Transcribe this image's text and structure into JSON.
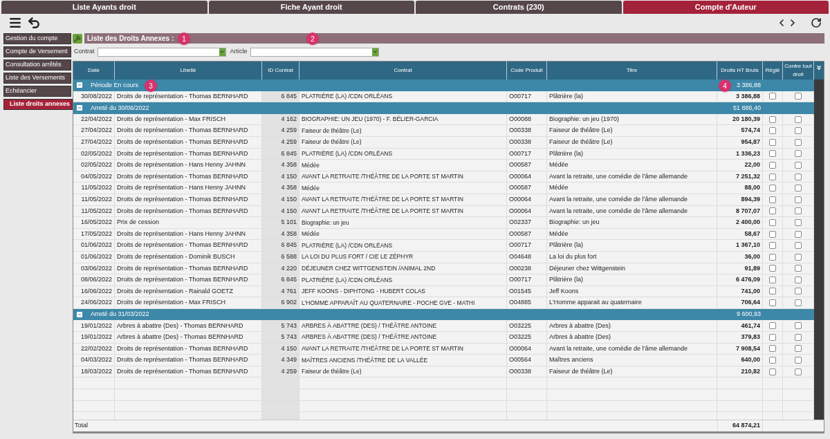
{
  "tabs": [
    {
      "label": "Liste Ayants droit",
      "selected": false
    },
    {
      "label": "Fiche Ayant droit",
      "selected": false
    },
    {
      "label": "Contrats (230)",
      "selected": false
    },
    {
      "label": "Compte d'Auteur",
      "selected": true
    }
  ],
  "sidebar": {
    "items": [
      {
        "label": "Gestion du compte",
        "selected": false
      },
      {
        "label": "Compte de Versement",
        "selected": false
      },
      {
        "label": "Consultation arrêtés",
        "selected": false
      },
      {
        "label": "Liste des Versements",
        "selected": false
      },
      {
        "label": "Echéancier",
        "selected": false
      },
      {
        "label": "Liste droits annexes",
        "selected": true
      }
    ]
  },
  "panel": {
    "title": "Liste des Droits Annexes :",
    "callouts": [
      "1",
      "2",
      "3",
      "4"
    ],
    "filters": [
      {
        "label": "Contrat"
      },
      {
        "label": "Article"
      }
    ]
  },
  "table": {
    "columns": [
      "Date",
      "Libellé",
      "ID Contrat",
      "Contrat",
      "Code Produit",
      "Titre",
      "Droits HT Bruts",
      "Réglé",
      "Contre tout droit"
    ],
    "groups": [
      {
        "label": "Période En cours",
        "total": "3 386,88",
        "expanded": true,
        "rows": [
          {
            "date": "30/08/2022",
            "libelle": "Droits de représentation - Thomas BERNHARD",
            "id_contrat": "6 845",
            "contrat": "PLATRIÈRE (LA) /CDN ORLÉANS",
            "code_produit": "O00717",
            "titre": "Plâtrière (la)",
            "droits": "3 386,88",
            "regle": false,
            "contre_tout_droit": false
          }
        ]
      },
      {
        "label": "Arreté du 30/06/2022",
        "total": "51 886,40",
        "expanded": true,
        "rows": [
          {
            "date": "22/04/2022",
            "libelle": "Droits de représentation - Max FRISCH",
            "id_contrat": "4 162",
            "contrat": "BIOGRAPHIE: UN JEU (1970) - F. BÉLIER-GARCIA",
            "code_produit": "O00088",
            "titre": "Biographie: un jeu (1970)",
            "droits": "20 180,39",
            "regle": false,
            "contre_tout_droit": false
          },
          {
            "date": "27/04/2022",
            "libelle": "Droits de représentation - Thomas BERNHARD",
            "id_contrat": "4 259",
            "contrat": "Faiseur de théâtre (Le)",
            "code_produit": "O00338",
            "titre": "Faiseur de théâtre (Le)",
            "droits": "574,74",
            "regle": false,
            "contre_tout_droit": false
          },
          {
            "date": "27/04/2022",
            "libelle": "Droits de représentation - Thomas BERNHARD",
            "id_contrat": "4 259",
            "contrat": "Faiseur de théâtre (Le)",
            "code_produit": "O00338",
            "titre": "Faiseur de théâtre (Le)",
            "droits": "954,87",
            "regle": false,
            "contre_tout_droit": false
          },
          {
            "date": "02/05/2022",
            "libelle": "Droits de représentation - Thomas BERNHARD",
            "id_contrat": "6 845",
            "contrat": "PLATRIÈRE (LA) /CDN ORLÉANS",
            "code_produit": "O00717",
            "titre": "Plâtrière (la)",
            "droits": "1 336,23",
            "regle": false,
            "contre_tout_droit": false
          },
          {
            "date": "02/05/2022",
            "libelle": "Droits de représentation - Hans Henny JAHNN",
            "id_contrat": "4 358",
            "contrat": "Médée",
            "code_produit": "O00587",
            "titre": "Médée",
            "droits": "22,00",
            "regle": false,
            "contre_tout_droit": false
          },
          {
            "date": "04/05/2022",
            "libelle": "Droits de représentation - Thomas BERNHARD",
            "id_contrat": "4 150",
            "contrat": "AVANT LA RETRAITE /THÉÂTRE DE LA PORTE ST MARTIN",
            "code_produit": "O00064",
            "titre": "Avant la retraite, une comédie de l’âme allemande",
            "droits": "7 251,32",
            "regle": false,
            "contre_tout_droit": false
          },
          {
            "date": "11/05/2022",
            "libelle": "Droits de représentation - Hans Henny JAHNN",
            "id_contrat": "4 358",
            "contrat": "Médée",
            "code_produit": "O00587",
            "titre": "Médée",
            "droits": "88,00",
            "regle": false,
            "contre_tout_droit": false
          },
          {
            "date": "11/05/2022",
            "libelle": "Droits de représentation - Thomas BERNHARD",
            "id_contrat": "4 150",
            "contrat": "AVANT LA RETRAITE /THÉÂTRE DE LA PORTE ST MARTIN",
            "code_produit": "O00064",
            "titre": "Avant la retraite, une comédie de l’âme allemande",
            "droits": "894,39",
            "regle": false,
            "contre_tout_droit": false
          },
          {
            "date": "11/05/2022",
            "libelle": "Droits de représentation - Thomas BERNHARD",
            "id_contrat": "4 150",
            "contrat": "AVANT LA RETRAITE /THÉÂTRE DE LA PORTE ST MARTIN",
            "code_produit": "O00064",
            "titre": "Avant la retraite, une comédie de l’âme allemande",
            "droits": "8 707,07",
            "regle": false,
            "contre_tout_droit": false
          },
          {
            "date": "16/05/2022",
            "libelle": "Prix de cession",
            "id_contrat": "5 101",
            "contrat": "Biographie: un jeu",
            "code_produit": "O02337",
            "titre": "Biographie: un jeu",
            "droits": "2 400,00",
            "regle": false,
            "contre_tout_droit": false
          },
          {
            "date": "17/05/2022",
            "libelle": "Droits de représentation - Hans Henny JAHNN",
            "id_contrat": "4 358",
            "contrat": "Médée",
            "code_produit": "O00587",
            "titre": "Médée",
            "droits": "58,67",
            "regle": false,
            "contre_tout_droit": false
          },
          {
            "date": "01/06/2022",
            "libelle": "Droits de représentation - Thomas BERNHARD",
            "id_contrat": "6 845",
            "contrat": "PLATRIÈRE (LA) /CDN ORLÉANS",
            "code_produit": "O00717",
            "titre": "Plâtrière (la)",
            "droits": "1 367,10",
            "regle": false,
            "contre_tout_droit": false
          },
          {
            "date": "01/06/2022",
            "libelle": "Droits de représentation - Dominik BUSCH",
            "id_contrat": "6 588",
            "contrat": "LA LOI DU PLUS FORT / CIE LE ZÉPHYR",
            "code_produit": "O04648",
            "titre": "La loi du plus fort",
            "droits": "36,00",
            "regle": false,
            "contre_tout_droit": false
          },
          {
            "date": "03/06/2022",
            "libelle": "Droits de représentation - Thomas BERNHARD",
            "id_contrat": "4 220",
            "contrat": "DÉJEUNER CHEZ WITTGENSTEIN /ANIMAL 2ND",
            "code_produit": "O00238",
            "titre": "Déjeuner chez Wittgenstein",
            "droits": "91,89",
            "regle": false,
            "contre_tout_droit": false
          },
          {
            "date": "08/06/2022",
            "libelle": "Droits de représentation - Thomas BERNHARD",
            "id_contrat": "6 845",
            "contrat": "PLATRIÈRE (LA) /CDN ORLÉANS",
            "code_produit": "O00717",
            "titre": "Plâtrière (la)",
            "droits": "6 476,09",
            "regle": false,
            "contre_tout_droit": false
          },
          {
            "date": "16/06/2022",
            "libelle": "Droits de représentation - Rainald GOETZ",
            "id_contrat": "4 761",
            "contrat": "JEFF KOONS - DIPHTONG - HUBERT COLAS",
            "code_produit": "O01545",
            "titre": "Jeff Koons",
            "droits": "741,00",
            "regle": false,
            "contre_tout_droit": false
          },
          {
            "date": "24/06/2022",
            "libelle": "Droits de représentation - Max FRISCH",
            "id_contrat": "6 902",
            "contrat": "L'HOMME APPARAÎT AU QUATERNAIRE - POCHE GVE - MATHI",
            "code_produit": "O04885",
            "titre": "L'Homme apparait au quaternaire",
            "droits": "706,64",
            "regle": false,
            "contre_tout_droit": false
          }
        ]
      },
      {
        "label": "Arreté du 31/03/2022",
        "total": "9 600,93",
        "expanded": true,
        "rows": [
          {
            "date": "19/01/2022",
            "libelle": "Arbres à abattre (Des) - Thomas BERNHARD",
            "id_contrat": "5 743",
            "contrat": "ARBRES À ABATTRE (DES) / THÉÂTRE ANTOINE",
            "code_produit": "O03225",
            "titre": "Arbres à abattre (Des)",
            "droits": "461,74",
            "regle": false,
            "contre_tout_droit": false
          },
          {
            "date": "19/01/2022",
            "libelle": "Arbres à abattre (Des) - Thomas BERNHARD",
            "id_contrat": "5 743",
            "contrat": "ARBRES À ABATTRE (DES) / THÉÂTRE ANTOINE",
            "code_produit": "O03225",
            "titre": "Arbres à abattre (Des)",
            "droits": "379,83",
            "regle": false,
            "contre_tout_droit": false
          },
          {
            "date": "22/02/2022",
            "libelle": "Droits de représentation - Thomas BERNHARD",
            "id_contrat": "4 150",
            "contrat": "AVANT LA RETRAITE /THÉÂTRE DE LA PORTE ST MARTIN",
            "code_produit": "O00064",
            "titre": "Avant la retraite, une comédie de l’âme allemande",
            "droits": "7 908,54",
            "regle": false,
            "contre_tout_droit": false
          },
          {
            "date": "04/03/2022",
            "libelle": "Droits de représentation - Thomas BERNHARD",
            "id_contrat": "4 349",
            "contrat": "MAÎTRES ANCIENS /THÉÂTRE DE LA VALLÉE",
            "code_produit": "O00564",
            "titre": "Maîtres anciens",
            "droits": "640,00",
            "regle": false,
            "contre_tout_droit": false
          },
          {
            "date": "18/03/2022",
            "libelle": "Droits de représentation - Thomas BERNHARD",
            "id_contrat": "4 259",
            "contrat": "Faiseur de théâtre (Le)",
            "code_produit": "O00338",
            "titre": "Faiseur de théâtre (Le)",
            "droits": "210,82",
            "regle": false,
            "contre_tout_droit": false
          }
        ]
      }
    ],
    "total": {
      "label": "Total",
      "value": "64 874,21"
    }
  }
}
